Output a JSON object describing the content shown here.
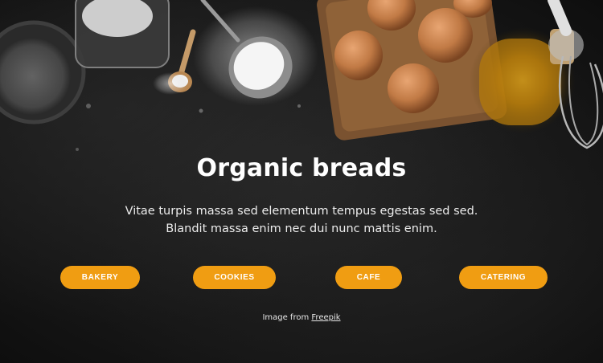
{
  "hero": {
    "title": "Organic breads",
    "lead_line1": "Vitae turpis massa sed elementum tempus egestas sed sed.",
    "lead_line2": "Blandit massa enim nec dui nunc mattis enim."
  },
  "buttons": {
    "bakery": "BAKERY",
    "cookies": "COOKIES",
    "cafe": "CAFE",
    "catering": "CATERING"
  },
  "credit": {
    "prefix": "Image from",
    "link_label": "Freepik"
  },
  "colors": {
    "accent": "#f09d12",
    "background": "#141414",
    "text": "#ffffff"
  }
}
